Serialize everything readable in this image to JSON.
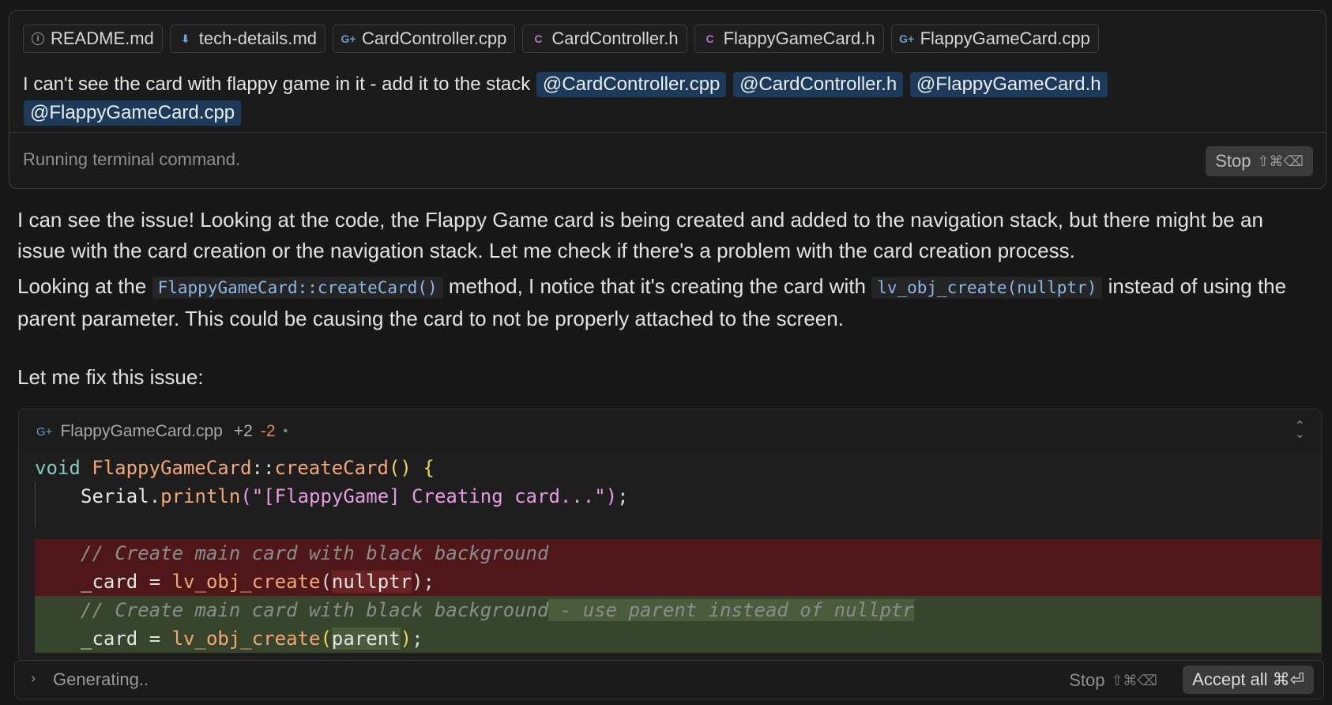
{
  "context_chips": [
    {
      "label": "README.md",
      "icon": "info-icon"
    },
    {
      "label": "tech-details.md",
      "icon": "markdown-download-icon"
    },
    {
      "label": "CardController.cpp",
      "icon": "cpp-file-icon"
    },
    {
      "label": "CardController.h",
      "icon": "c-header-icon"
    },
    {
      "label": "FlappyGameCard.h",
      "icon": "c-header-icon"
    },
    {
      "label": "FlappyGameCard.cpp",
      "icon": "cpp-file-icon"
    }
  ],
  "prompt": {
    "text": "I can't see the card with flappy game in it - add it to the stack",
    "mentions": [
      "@CardController.cpp",
      "@CardController.h",
      "@FlappyGameCard.h",
      "@FlappyGameCard.cpp"
    ]
  },
  "status": {
    "text": "Running terminal command.",
    "stop_label": "Stop",
    "stop_shortcut": "⇧⌘⌫"
  },
  "message": {
    "p1": "I can see the issue! Looking at the code, the Flappy Game card is being created and added to the navigation stack, but there might be an issue with the card creation or the navigation stack. Let me check if there's a problem with the card creation process.",
    "p2_a": "Looking at the",
    "p2_code1": "FlappyGameCard::createCard()",
    "p2_b": "method, I notice that it's creating the card with",
    "p2_code2": "lv_obj_create(nullptr)",
    "p2_c": "instead of using the parent parameter. This could be causing the card to not be properly attached to the screen.",
    "p3": "Let me fix this issue:"
  },
  "code_block": {
    "filename": "FlappyGameCard.cpp",
    "added": "+2",
    "removed": "-2",
    "status_dot": "•",
    "lines": {
      "l1_kw": "void",
      "l1_cls": "FlappyGameCard",
      "l1_sep": "::",
      "l1_fn": "createCard",
      "l1_paren": "()",
      "l1_brace": "{",
      "l2_obj": "Serial",
      "l2_fn": "println",
      "l2_str": "\"[FlappyGame] Creating card...\"",
      "del_comment": "// Create main card with black background",
      "del_var": "_card",
      "del_fn": "lv_obj_create",
      "del_arg": "nullptr",
      "ins_comment_a": "// Create main card with black background",
      "ins_comment_b": " - use parent instead of nullptr",
      "ins_var": "_card",
      "ins_fn": "lv_obj_create",
      "ins_arg": "parent"
    }
  },
  "generating_bar": {
    "text": "Generating..",
    "stop_label": "Stop",
    "stop_shortcut": "⇧⌘⌫",
    "accept_label": "Accept all",
    "accept_shortcut": "⌘⏎"
  },
  "colors": {
    "background": "#181818",
    "mention_bg": "#1d3a5a",
    "deleted_line_bg": "#4f1719",
    "inserted_line_bg": "#37452d"
  }
}
